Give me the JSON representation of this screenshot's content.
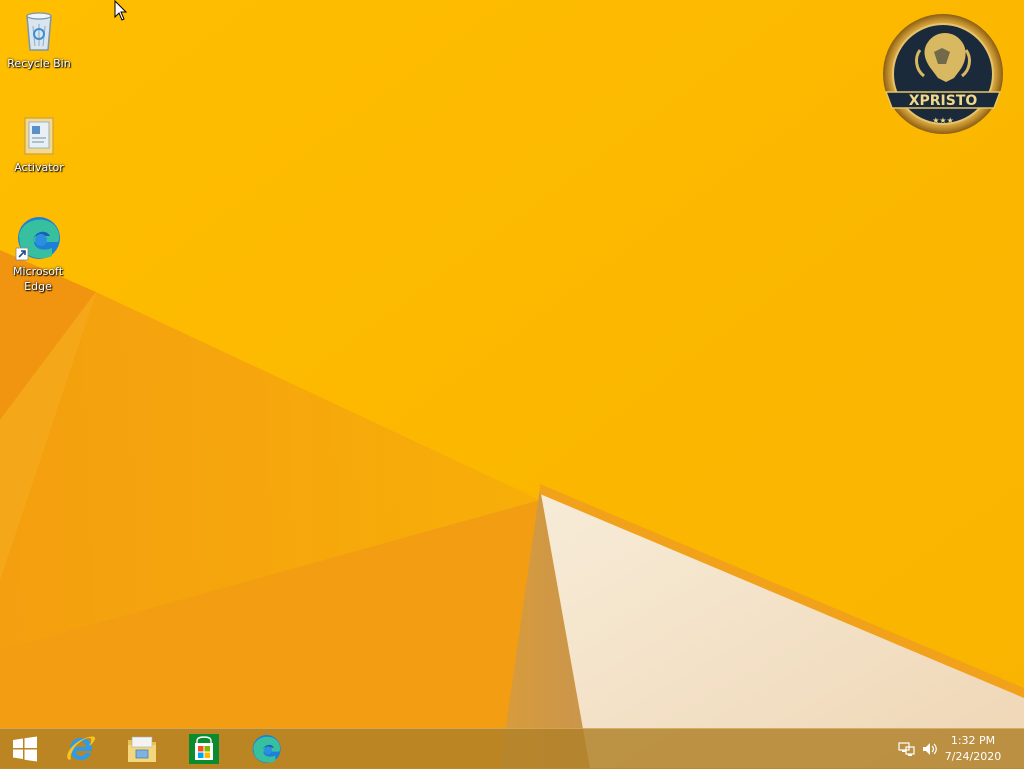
{
  "desktop": {
    "icons": [
      {
        "label": "Recycle Bin",
        "icon": "recycle-bin-icon"
      },
      {
        "label": "Activator",
        "icon": "activator-file-icon"
      },
      {
        "label": "Microsoft Edge",
        "label_line1": "Microsoft",
        "label_line2": "Edge",
        "icon": "edge-icon"
      }
    ],
    "logo": {
      "text": "XPRISTO",
      "stars": "★★★"
    }
  },
  "taskbar": {
    "items": [
      {
        "name": "Start",
        "icon": "windows-start-icon"
      },
      {
        "name": "Internet Explorer",
        "icon": "internet-explorer-icon"
      },
      {
        "name": "File Explorer",
        "icon": "file-explorer-icon"
      },
      {
        "name": "Store",
        "icon": "store-icon"
      },
      {
        "name": "Microsoft Edge",
        "icon": "edge-icon"
      }
    ],
    "tray": {
      "network_icon": "network-icon",
      "volume_icon": "volume-icon",
      "time": "1:32 PM",
      "date": "7/24/2020"
    }
  },
  "colors": {
    "wallpaper_base": "#fbb900",
    "wallpaper_orange": "#f39a10",
    "wallpaper_cream": "#f3dfc4",
    "taskbar": "#b08028"
  }
}
